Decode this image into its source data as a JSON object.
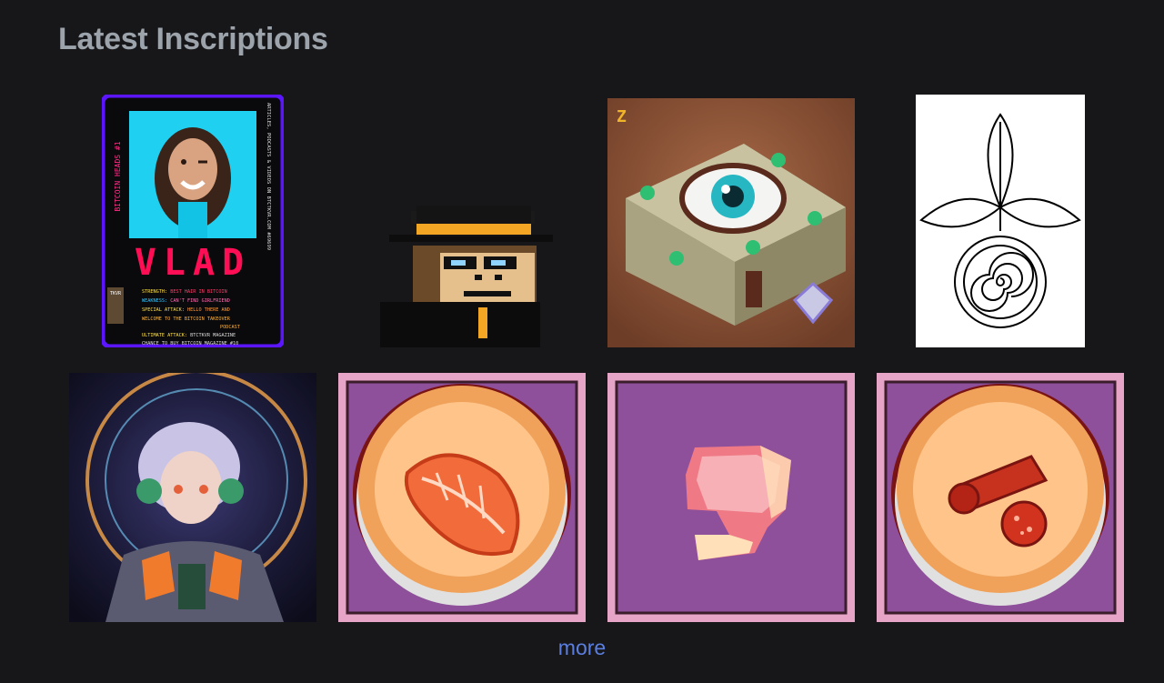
{
  "page": {
    "title": "Latest Inscriptions",
    "more_label": "more"
  },
  "cards": {
    "vlad": {
      "side_left": "BITCOIN HEADS #1",
      "side_right": "ARTICLES, PODCASTS & VIDEOS ON BTCTKVR.COM #69699",
      "name": "VLAD",
      "stats": [
        {
          "label": "STRENGTH:",
          "value": "BEST HAIR IN BITCOIN"
        },
        {
          "label": "WEAKNESS:",
          "value": "CAN'T FIND GIRLFRIEND"
        },
        {
          "label": "SPECIAL ATTACK:",
          "value": "HELLO THERE AND"
        },
        {
          "label": "",
          "value": "WELCOME TO THE BITCOIN TAKEOVER"
        },
        {
          "label": "",
          "value": "PODCAST"
        },
        {
          "label": "ULTIMATE ATTACK:",
          "value": "BTCTKVR MAGAZINE"
        },
        {
          "label": "",
          "value": "CHANCE TO BUY BITCOIN MAGAZINE #10"
        }
      ],
      "magazine": "TKVR"
    }
  },
  "colors": {
    "background": "#17171a",
    "title": "#9ca3ab",
    "link": "#5b7fe0",
    "card_border": "#5b16ff",
    "plate_frame": "#8e4f9b"
  }
}
